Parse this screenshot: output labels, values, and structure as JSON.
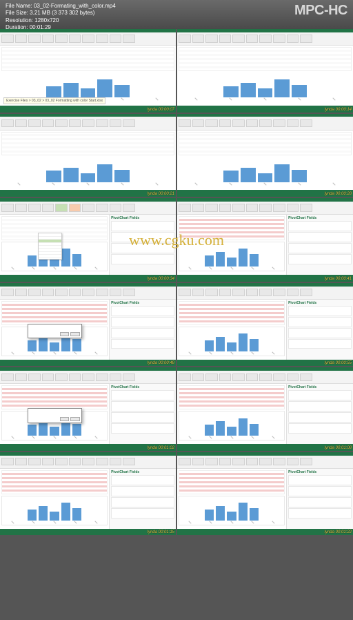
{
  "app": {
    "name": "MPC-HC"
  },
  "fileinfo": {
    "name_label": "File Name:",
    "name": "03_02-Formating_with_color.mp4",
    "size_label": "File Size:",
    "size": "3.21 MB (3 373 302 bytes)",
    "res_label": "Resolution:",
    "res": "1280x720",
    "dur_label": "Duration:",
    "dur": "00:01:29"
  },
  "watermark": "www.cgku.com",
  "timestamp_prefix": "lynda",
  "sidepanel_title": "PivotChart Fields",
  "tooltip_text": "Exercise Files > 03_02 > 03_02 Formatting with color Start.xlsx",
  "thumbs": [
    {
      "ts": "00:00:07",
      "side": false,
      "tooltip": true,
      "hl": false,
      "ctx": false,
      "dlg": false,
      "pink": false
    },
    {
      "ts": "00:00:14",
      "side": false,
      "tooltip": false,
      "hl": false,
      "ctx": false,
      "dlg": false,
      "pink": false
    },
    {
      "ts": "00:00:21",
      "side": false,
      "tooltip": false,
      "hl": false,
      "ctx": false,
      "dlg": false,
      "pink": false
    },
    {
      "ts": "00:00:28",
      "side": false,
      "tooltip": false,
      "hl": false,
      "ctx": false,
      "dlg": false,
      "pink": false
    },
    {
      "ts": "00:00:34",
      "side": true,
      "tooltip": false,
      "hl": false,
      "ctx": true,
      "dlg": false,
      "pink": true
    },
    {
      "ts": "00:00:41",
      "side": true,
      "tooltip": false,
      "hl": true,
      "ctx": false,
      "dlg": false,
      "pink": false
    },
    {
      "ts": "00:00:48",
      "side": true,
      "tooltip": false,
      "hl": true,
      "ctx": false,
      "dlg": true,
      "pink": false
    },
    {
      "ts": "00:00:55",
      "side": true,
      "tooltip": false,
      "hl": true,
      "ctx": false,
      "dlg": false,
      "pink": false
    },
    {
      "ts": "00:01:02",
      "side": true,
      "tooltip": false,
      "hl": true,
      "ctx": false,
      "dlg": true,
      "pink": false
    },
    {
      "ts": "00:01:08",
      "side": true,
      "tooltip": false,
      "hl": true,
      "ctx": false,
      "dlg": false,
      "pink": false
    },
    {
      "ts": "00:01:15",
      "side": true,
      "tooltip": false,
      "hl": true,
      "ctx": false,
      "dlg": false,
      "pink": false
    },
    {
      "ts": "00:01:22",
      "side": true,
      "tooltip": false,
      "hl": true,
      "ctx": false,
      "dlg": false,
      "pink": false
    }
  ]
}
